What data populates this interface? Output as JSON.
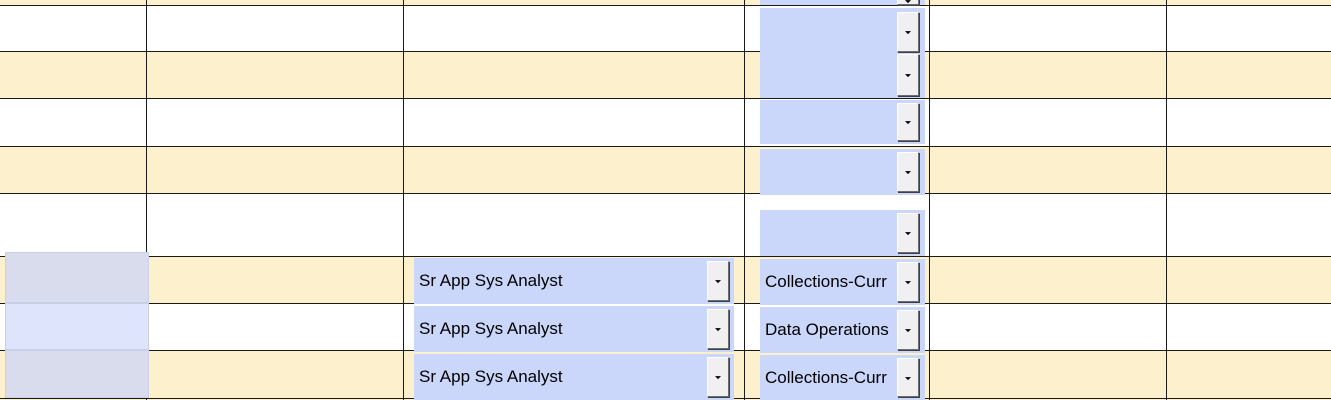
{
  "colors": {
    "band_alt": "#fdf0cd",
    "band_plain": "#ffffff",
    "dropdown_bg": "#cad6fa",
    "grid_line": "#1a1a1a",
    "selected_cell": "#d9dcec"
  },
  "rows": [
    {
      "band": "alt"
    },
    {
      "band": "plain"
    },
    {
      "band": "alt"
    },
    {
      "band": "plain"
    },
    {
      "band": "alt"
    },
    {
      "band": "plain"
    },
    {
      "band": "alt",
      "title": "Sr App Sys Analyst",
      "department": "Collections-Curr"
    },
    {
      "band": "plain",
      "title": "Sr App Sys Analyst",
      "department": "Data Operations"
    },
    {
      "band": "alt",
      "title": "Sr App Sys Analyst",
      "department": "Collections-Curr"
    }
  ]
}
